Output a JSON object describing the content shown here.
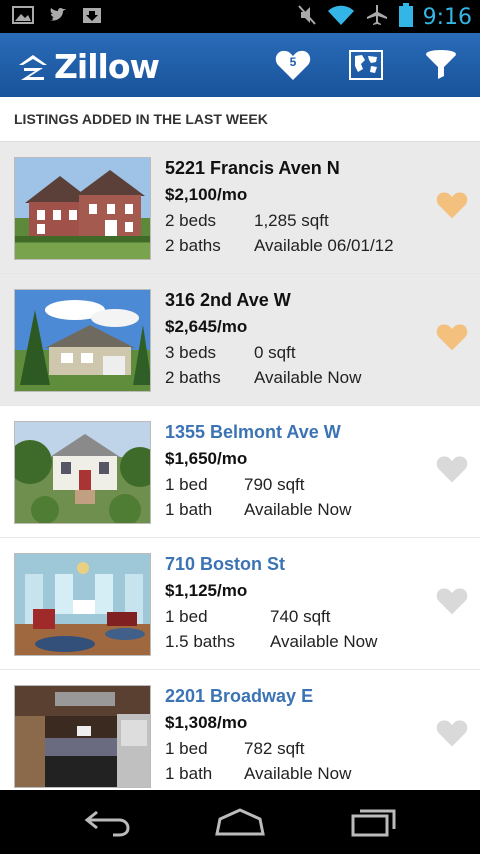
{
  "statusbar": {
    "time": "9:16",
    "icons": [
      "image-icon",
      "twitter-icon",
      "download-icon",
      "mute-icon",
      "wifi-icon",
      "airplane-icon",
      "battery-icon"
    ]
  },
  "actionbar": {
    "logo_text": "Zillow",
    "favorites_count": "5",
    "icons": [
      "favorites-heart-icon",
      "map-icon",
      "filter-icon"
    ],
    "accent_color": "#1f5fa8"
  },
  "section_header": "LISTINGS ADDED IN THE LAST WEEK",
  "listings": [
    {
      "address": "5221 Francis Aven N",
      "price": "$2,100/mo",
      "beds": "2 beds",
      "sqft": "1,285 sqft",
      "baths": "2 baths",
      "available": "Available 06/01/12",
      "viewed": true,
      "favorited": true
    },
    {
      "address": "316 2nd Ave W",
      "price": "$2,645/mo",
      "beds": "3 beds",
      "sqft": "0 sqft",
      "baths": "2 baths",
      "available": "Available Now",
      "viewed": true,
      "favorited": true
    },
    {
      "address": "1355 Belmont Ave W",
      "price": "$1,650/mo",
      "beds": "1 bed",
      "sqft": "790 sqft",
      "baths": "1 bath",
      "available": "Available Now",
      "viewed": false,
      "favorited": false
    },
    {
      "address": "710 Boston St",
      "price": "$1,125/mo",
      "beds": "1 bed",
      "sqft": "740 sqft",
      "baths": "1.5 baths",
      "available": "Available Now",
      "viewed": false,
      "favorited": false
    },
    {
      "address": "2201 Broadway E",
      "price": "$1,308/mo",
      "beds": "1 bed",
      "sqft": "782 sqft",
      "baths": "1 bath",
      "available": "Available Now",
      "viewed": false,
      "favorited": false
    }
  ],
  "colors": {
    "favorited_heart": "#f3c07e",
    "unfavorited_heart": "#d9d9d9",
    "new_listing_link": "#3b73b4"
  },
  "navbar": {
    "icons": [
      "back-icon",
      "home-icon",
      "recent-apps-icon"
    ]
  }
}
